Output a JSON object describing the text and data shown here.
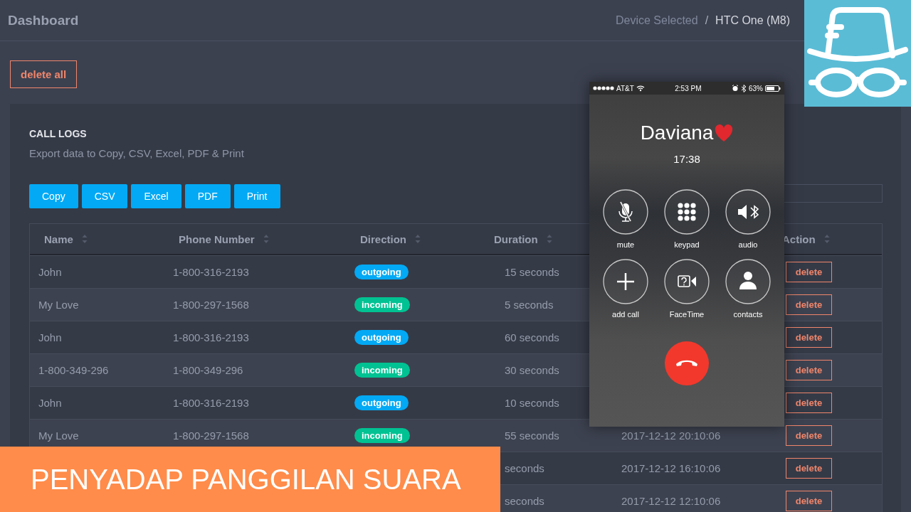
{
  "header": {
    "title": "Dashboard",
    "breadcrumb": {
      "parent": "Device Selected",
      "separator": "/",
      "current": "HTC One (M8)"
    }
  },
  "delete_all": "delete all",
  "call_logs": {
    "title": "CALL LOGS",
    "subtitle": "Export data to Copy, CSV, Excel, PDF & Print",
    "export_buttons": [
      "Copy",
      "CSV",
      "Excel",
      "PDF",
      "Print"
    ],
    "columns": [
      "Name",
      "Phone Number",
      "Direction",
      "Duration",
      "Action"
    ],
    "rows": [
      {
        "name": "John",
        "phone": "1-800-316-2193",
        "direction": {
          "label": "outgoing",
          "kind": "outgoing"
        },
        "duration": "15 seconds",
        "action": "delete"
      },
      {
        "name": "My Love",
        "phone": "1-800-297-1568",
        "direction": {
          "label": "incoming",
          "kind": "incoming"
        },
        "duration": "5 seconds",
        "action": "delete"
      },
      {
        "name": "John",
        "phone": "1-800-316-2193",
        "direction": {
          "label": "outgoing",
          "kind": "outgoing"
        },
        "duration": "60 seconds",
        "action": "delete"
      },
      {
        "name": "1-800-349-296",
        "phone": "1-800-349-296",
        "direction": {
          "label": "incoming",
          "kind": "incoming"
        },
        "duration": "30 seconds",
        "action": "delete"
      },
      {
        "name": "John",
        "phone": "1-800-316-2193",
        "direction": {
          "label": "outgoing",
          "kind": "outgoing"
        },
        "duration": "10 seconds",
        "action": "delete"
      },
      {
        "name": "My Love",
        "phone": "1-800-297-1568",
        "direction": {
          "label": "incoming",
          "kind": "incoming"
        },
        "duration": "55 seconds",
        "date": "2017-12-12 20:10:06",
        "action": "delete"
      },
      {
        "duration": "seconds",
        "date": "2017-12-12 16:10:06",
        "action": "delete"
      },
      {
        "duration": "seconds",
        "date": "2017-12-12 12:10:06",
        "action": "delete"
      }
    ]
  },
  "phone_call": {
    "carrier": "AT&T",
    "time": "2:53 PM",
    "battery": "63%",
    "caller": "Daviana",
    "elapsed": "17:38",
    "buttons": [
      {
        "label": "mute",
        "kind": "mute"
      },
      {
        "label": "keypad",
        "kind": "keypad"
      },
      {
        "label": "audio",
        "kind": "audio"
      },
      {
        "label": "add call",
        "kind": "add"
      },
      {
        "label": "FaceTime",
        "kind": "facetime"
      },
      {
        "label": "contacts",
        "kind": "contacts"
      }
    ]
  },
  "banner": {
    "text": "PENYADAP PANGGILAN SUARA"
  }
}
